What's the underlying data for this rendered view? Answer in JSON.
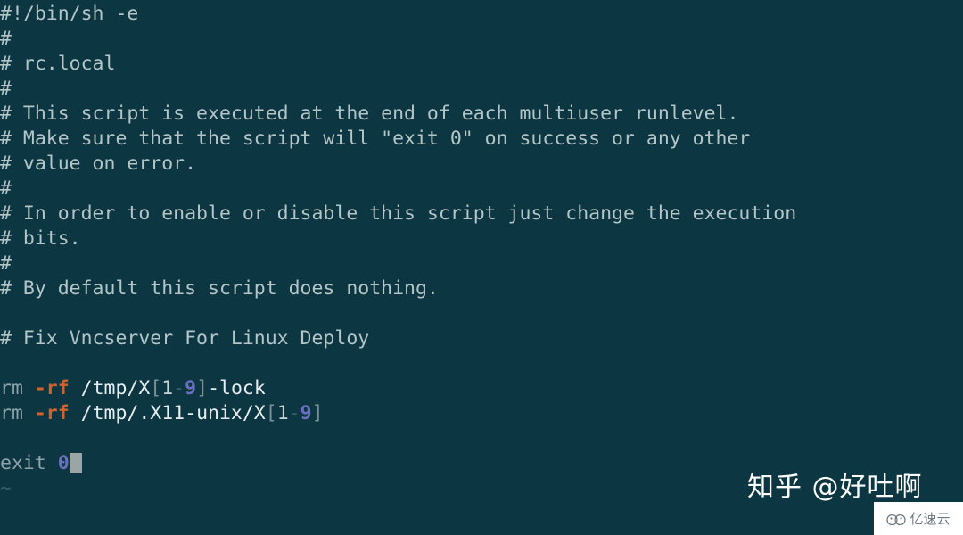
{
  "terminal": {
    "background_color": "#0b3642",
    "foreground_color": "#b3c4c6",
    "colors": {
      "comment": "#b4c5c7",
      "command": "#8fa3a8",
      "flag": "#d2622a",
      "path": "#e8eef0",
      "bracket": "#7d9097",
      "number": "#6a6fc0",
      "tilde": "#2d5f74",
      "cursor": "#9aa6a6"
    },
    "lines": [
      {
        "id": 1,
        "text": "#!/bin/sh -e"
      },
      {
        "id": 2,
        "text": "#"
      },
      {
        "id": 3,
        "text": "# rc.local"
      },
      {
        "id": 4,
        "text": "#"
      },
      {
        "id": 5,
        "text": "# This script is executed at the end of each multiuser runlevel."
      },
      {
        "id": 6,
        "text": "# Make sure that the script will \"exit 0\" on success or any other"
      },
      {
        "id": 7,
        "text": "# value on error."
      },
      {
        "id": 8,
        "text": "#"
      },
      {
        "id": 9,
        "text": "# In order to enable or disable this script just change the execution"
      },
      {
        "id": 10,
        "text": "# bits."
      },
      {
        "id": 11,
        "text": "#"
      },
      {
        "id": 12,
        "text": "# By default this script does nothing."
      },
      {
        "id": 13,
        "text": ""
      },
      {
        "id": 14,
        "text": "# Fix Vncserver For Linux Deploy"
      },
      {
        "id": 15,
        "text": ""
      },
      {
        "id": 16,
        "text": "rm -rf /tmp/X[1-9]-lock"
      },
      {
        "id": 17,
        "text": "rm -rf /tmp/.X11-unix/X[1-9]"
      },
      {
        "id": 18,
        "text": ""
      },
      {
        "id": 19,
        "text": "exit 0"
      },
      {
        "id": 20,
        "text": "~"
      }
    ],
    "tokens": {
      "rm": "rm",
      "flag_rf": "-rf",
      "path_lock_a": " /tmp/X",
      "bracket_open": "[",
      "one": "1",
      "dash": "-",
      "nine": "9",
      "bracket_close": "]",
      "lock_suffix": "-lock",
      "path_unix": " /tmp/.X11-unix/X",
      "exit": "exit",
      "zero": "0",
      "tilde": "~"
    },
    "cursor": {
      "line": 19,
      "column": 7
    }
  },
  "watermarks": {
    "zhihu": "知乎 @好吐啊",
    "logo_text": "亿速云"
  }
}
